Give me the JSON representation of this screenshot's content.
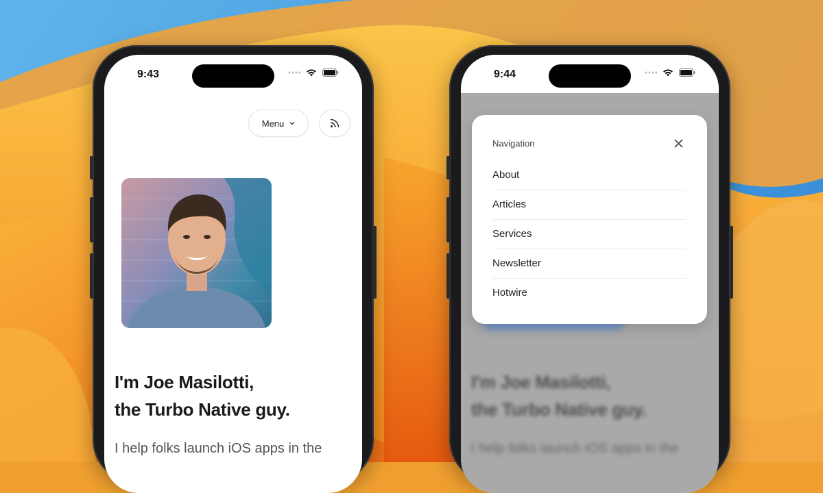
{
  "colors": {
    "wallpaper_orange": "#f39a28",
    "wallpaper_blue": "#4a9fe0",
    "phone_frame": "#1b1b1d",
    "dim_overlay": "#a9a9a9"
  },
  "left_phone": {
    "status": {
      "time": "9:43"
    },
    "header": {
      "menu_label": "Menu",
      "menu_icon": "chevron-down-icon",
      "rss_icon": "rss-icon"
    },
    "hero": {
      "portrait_icon": "person-portrait",
      "headline_line1": "I'm Joe Masilotti,",
      "headline_line2": "the Turbo Native guy.",
      "subtext": "I help folks launch iOS apps in the"
    }
  },
  "right_phone": {
    "status": {
      "time": "9:44"
    },
    "nav": {
      "title": "Navigation",
      "close_icon": "close-icon",
      "items": [
        {
          "label": "About"
        },
        {
          "label": "Articles"
        },
        {
          "label": "Services"
        },
        {
          "label": "Newsletter"
        },
        {
          "label": "Hotwire"
        }
      ]
    },
    "background": {
      "headline_line1": "I'm Joe Masilotti,",
      "headline_line2": "the Turbo Native guy.",
      "subtext": "I help folks launch iOS apps in the"
    }
  }
}
